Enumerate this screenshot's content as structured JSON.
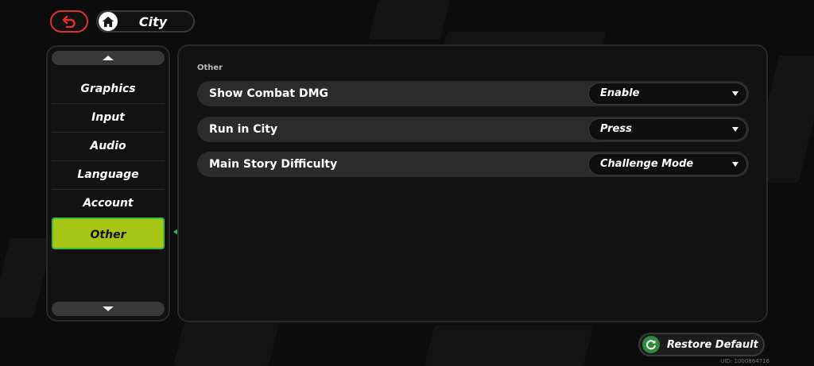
{
  "header": {
    "back_icon": "back-arrow-icon",
    "breadcrumb_icon": "home-icon",
    "breadcrumb_label": "City"
  },
  "sidebar": {
    "items": [
      {
        "label": "Graphics"
      },
      {
        "label": "Input"
      },
      {
        "label": "Audio"
      },
      {
        "label": "Language"
      },
      {
        "label": "Account"
      },
      {
        "label": "Other",
        "active": true
      }
    ]
  },
  "main": {
    "section_title": "Other",
    "settings": [
      {
        "label": "Show Combat DMG",
        "value": "Enable"
      },
      {
        "label": "Run in City",
        "value": "Press"
      },
      {
        "label": "Main Story Difficulty",
        "value": "Challenge Mode"
      }
    ]
  },
  "footer": {
    "restore_label": "Restore Default",
    "uid": "UID: 1000864716"
  },
  "colors": {
    "accent": "#a6c514",
    "arrow": "#2db84a",
    "back": "#e0322f"
  }
}
